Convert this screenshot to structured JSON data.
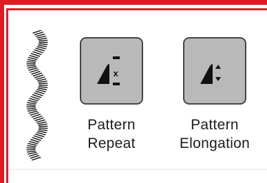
{
  "colors": {
    "frame": "#e01b24",
    "button_fill": "#b9b9b9",
    "button_border": "#444444",
    "icon": "#111111",
    "text": "#1c1c1c"
  },
  "preview": {
    "icon": "satin-wave-stitch-icon"
  },
  "tools": [
    {
      "icon": "pattern-repeat-icon",
      "label_line1": "Pattern",
      "label_line2": "Repeat",
      "icon_mark": "x"
    },
    {
      "icon": "pattern-elongation-icon",
      "label_line1": "Pattern",
      "label_line2": "Elongation"
    }
  ]
}
